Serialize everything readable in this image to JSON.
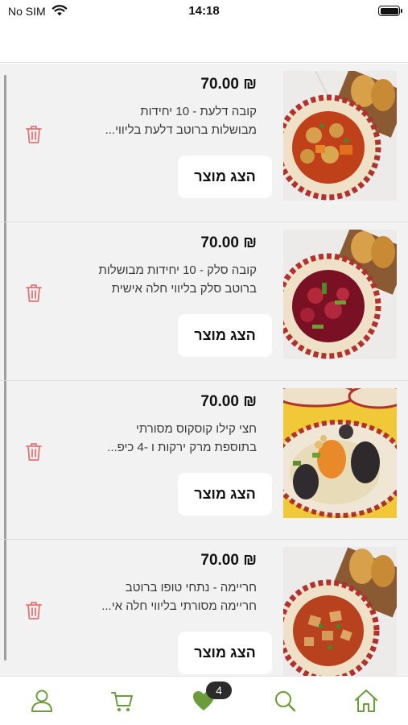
{
  "status_bar": {
    "carrier": "No SIM",
    "time": "14:18"
  },
  "products": [
    {
      "price": "₪ 70.00",
      "description_lines": [
        "קובה דלעת - 10 יחידות",
        "מבושלות ברוטב דלעת בליווי..."
      ],
      "show_label": "הצג מוצר",
      "image_icon": "soup-bowl-squash-image"
    },
    {
      "price": "₪ 70.00",
      "description_lines": [
        "קובה סלק - 10 יחידות מבושלות",
        "ברוטב סלק בליווי חלה אישית"
      ],
      "show_label": "הצג מוצר",
      "image_icon": "soup-bowl-beet-image"
    },
    {
      "price": "₪ 70.00",
      "description_lines": [
        "חצי קילו קוסקוס מסורתי",
        "בתוספת מרק ירקות ו -4 כיפ..."
      ],
      "show_label": "הצג מוצר",
      "image_icon": "couscous-plate-image"
    },
    {
      "price": "₪ 70.00",
      "description_lines": [
        "חריימה - נתחי טופו ברוטב",
        "חריימה מסורתי בליווי חלה אי..."
      ],
      "show_label": "הצג מוצר",
      "image_icon": "chraime-bowl-image"
    }
  ],
  "tab_bar": {
    "favorites_count": "4",
    "tabs": [
      "person-icon",
      "cart-icon",
      "heart-icon",
      "search-icon",
      "home-icon"
    ]
  },
  "colors": {
    "accent_green": "#6a9c3a",
    "trash_red": "#e57373",
    "list_background": "#f2f2f2"
  }
}
